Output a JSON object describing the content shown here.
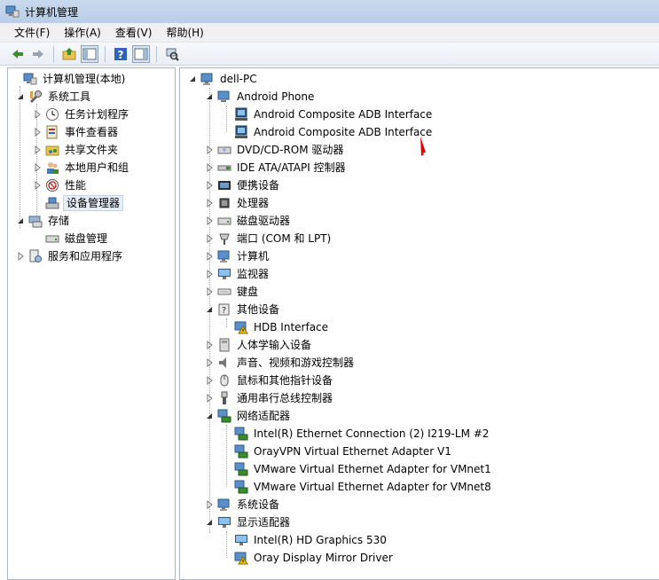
{
  "window": {
    "title": "计算机管理"
  },
  "menu": [
    "文件(F)",
    "操作(A)",
    "查看(V)",
    "帮助(H)"
  ],
  "toolbar": [
    "back-icon",
    "forward-icon",
    "up-folder-icon",
    "show-hide-tree-icon",
    "help-icon",
    "show-action-pane-icon",
    "scan-hardware-icon"
  ],
  "nav_tree": {
    "root": "计算机管理(本地)",
    "system_tools": "系统工具",
    "task_scheduler": "任务计划程序",
    "event_viewer": "事件查看器",
    "shared_folders": "共享文件夹",
    "local_users": "本地用户和组",
    "performance": "性能",
    "device_manager": "设备管理器",
    "storage": "存储",
    "disk_management": "磁盘管理",
    "services_apps": "服务和应用程序"
  },
  "device_tree": {
    "computer": "dell-PC",
    "android_phone": "Android Phone",
    "adb_1": "Android Composite ADB Interface",
    "adb_2": "Android Composite ADB Interface",
    "dvd": "DVD/CD-ROM 驱动器",
    "ide": "IDE ATA/ATAPI 控制器",
    "portable": "便携设备",
    "processor": "处理器",
    "disk_drives": "磁盘驱动器",
    "ports": "端口 (COM 和 LPT)",
    "computer_cat": "计算机",
    "monitors": "监视器",
    "keyboards": "键盘",
    "other_devices": "其他设备",
    "hdb": "HDB Interface",
    "hid": "人体学输入设备",
    "sound": "声音、视频和游戏控制器",
    "mice": "鼠标和其他指针设备",
    "usb": "通用串行总线控制器",
    "network": "网络适配器",
    "net_intel": "Intel(R) Ethernet Connection (2) I219-LM #2",
    "net_oray": "OrayVPN Virtual Ethernet Adapter V1",
    "net_vm1": "VMware Virtual Ethernet Adapter for VMnet1",
    "net_vm8": "VMware Virtual Ethernet Adapter for VMnet8",
    "system_devices": "系统设备",
    "display": "显示适配器",
    "gpu_intel": "Intel(R) HD Graphics 530",
    "gpu_oray": "Oray Display Mirror Driver"
  },
  "colors": {
    "accent": "#3c7fb1",
    "annotation": "#e00000",
    "warning": "#f2c200"
  }
}
